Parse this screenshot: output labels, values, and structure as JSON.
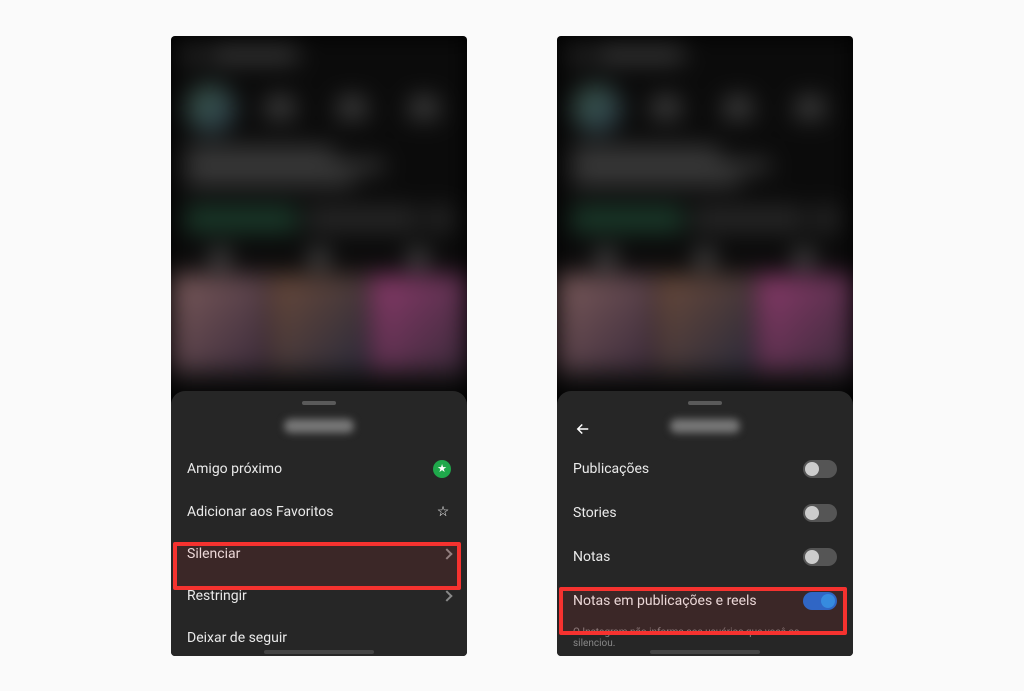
{
  "left": {
    "menu": {
      "close_friend": "Amigo próximo",
      "add_favorites": "Adicionar aos Favoritos",
      "mute": "Silenciar",
      "restrict": "Restringir",
      "unfollow": "Deixar de seguir"
    }
  },
  "right": {
    "options": {
      "posts": "Publicações",
      "stories": "Stories",
      "notes": "Notas",
      "notes_posts_reels": "Notas em publicações e reels"
    },
    "toggles": {
      "posts": false,
      "stories": false,
      "notes": false,
      "notes_posts_reels": true
    },
    "footnote": "O Instagram não informa aos usuários que você os silenciou."
  },
  "icons": {
    "star_filled": "★",
    "star_outline": "☆",
    "back_arrow": "←"
  }
}
